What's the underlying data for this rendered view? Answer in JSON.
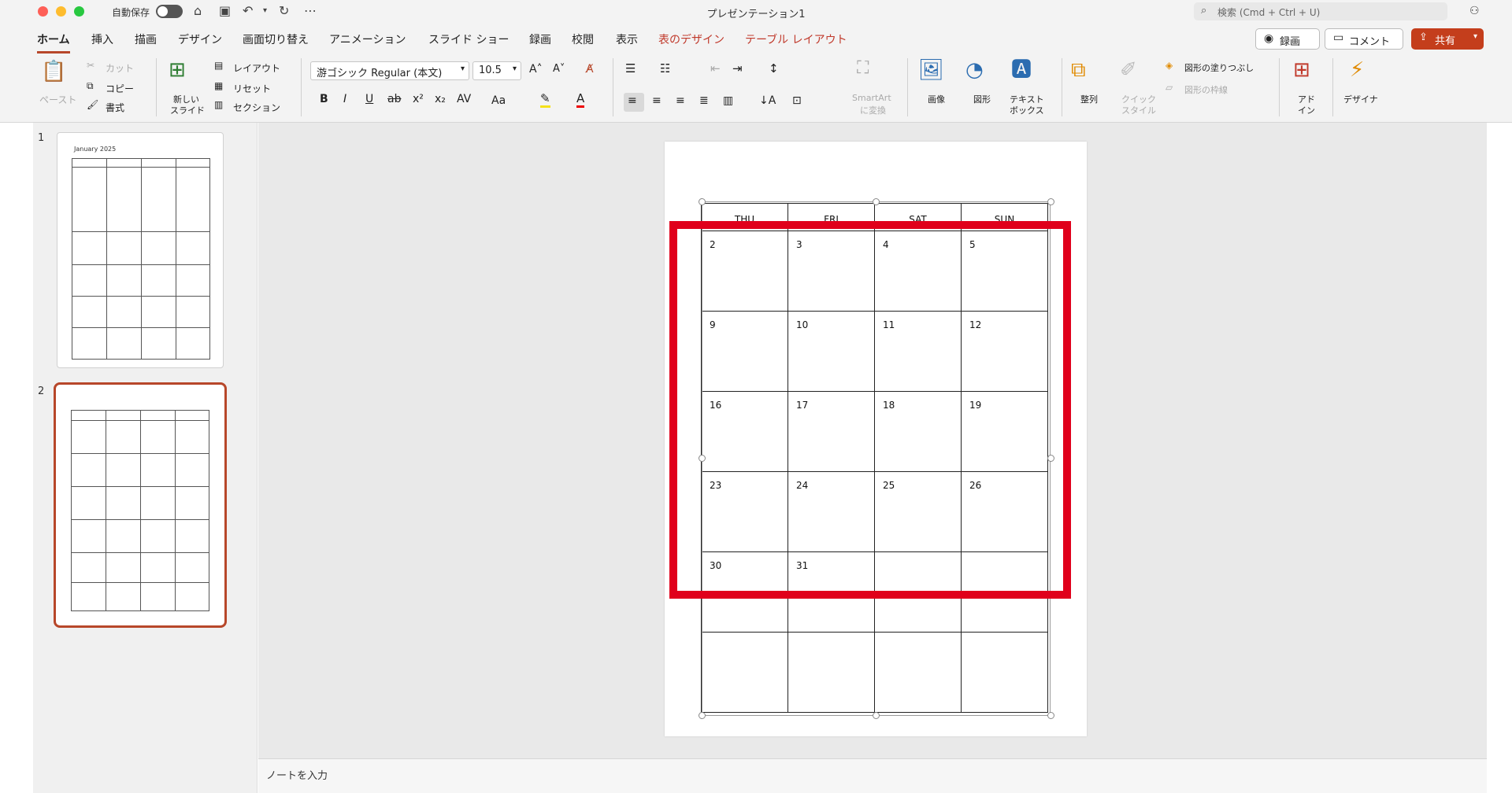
{
  "window": {
    "title": "プレゼンテーション1",
    "autosave_label": "自動保存",
    "search_placeholder": "検索 (Cmd + Ctrl + U)"
  },
  "ribbon_tabs": [
    "ホーム",
    "挿入",
    "描画",
    "デザイン",
    "画面切り替え",
    "アニメーション",
    "スライド ショー",
    "録画",
    "校閲",
    "表示",
    "表のデザイン",
    "テーブル レイアウト"
  ],
  "ribbon_actions": {
    "record": "録画",
    "comment": "コメント",
    "share": "共有"
  },
  "clipboard": {
    "paste": "ペースト",
    "cut": "カット",
    "copy": "コピー",
    "format": "書式"
  },
  "slides_group": {
    "new_slide_1": "新しい",
    "new_slide_2": "スライド",
    "layout": "レイアウト",
    "reset": "リセット",
    "section": "セクション"
  },
  "font": {
    "name": "游ゴシック Regular (本文)",
    "size": "10.5",
    "case_label": "Aa"
  },
  "insert_group": {
    "smartart_1": "SmartArt",
    "smartart_2": "に変換",
    "picture": "画像",
    "shape": "図形",
    "textbox_1": "テキスト",
    "textbox_2": "ボックス",
    "arrange": "整列",
    "quick_style_1": "クイック",
    "quick_style_2": "スタイル",
    "shape_fill": "図形の塗りつぶし",
    "shape_outline": "図形の枠線",
    "addin_1": "アド",
    "addin_2": "イン",
    "designer": "デザイナ"
  },
  "thumbnails": {
    "slide1_number": "1",
    "slide1_title": "January 2025",
    "slide2_number": "2"
  },
  "calendar": {
    "headers": [
      "THU",
      "FRI",
      "SAT",
      "SUN"
    ],
    "rows": [
      [
        "2",
        "3",
        "4",
        "5"
      ],
      [
        "9",
        "10",
        "11",
        "12"
      ],
      [
        "16",
        "17",
        "18",
        "19"
      ],
      [
        "23",
        "24",
        "25",
        "26"
      ],
      [
        "30",
        "31",
        "",
        ""
      ],
      [
        "",
        "",
        "",
        ""
      ]
    ]
  },
  "notes": {
    "placeholder": "ノートを入力"
  },
  "colors": {
    "accent": "#b7472a",
    "highlight": "#e0001b",
    "share": "#c43e1c",
    "context_tab": "#c0392b"
  }
}
